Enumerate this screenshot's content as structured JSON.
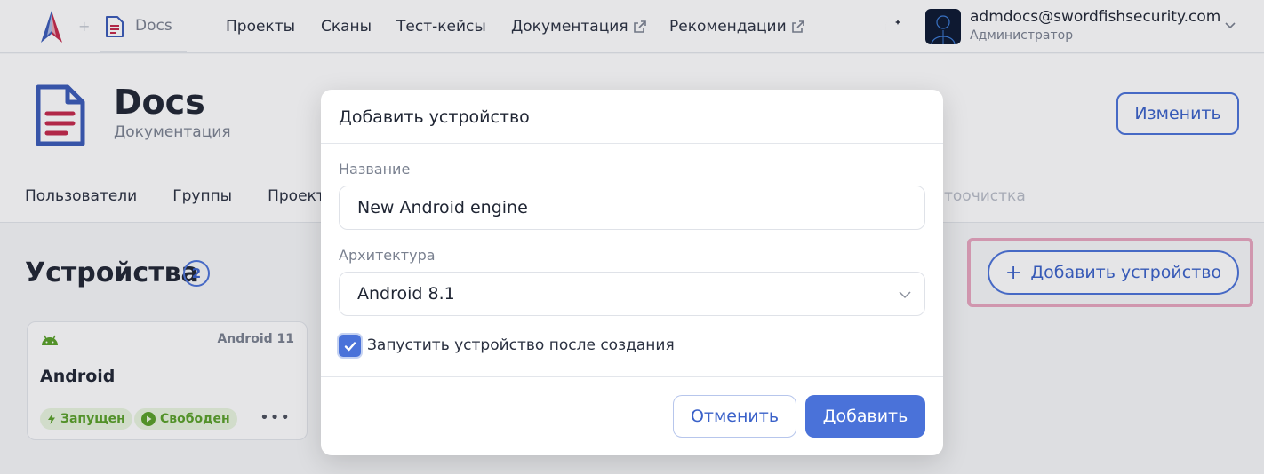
{
  "topbar": {
    "plus_sep": "+",
    "app_name": "Docs",
    "nav": [
      {
        "label": "Проекты",
        "external": false
      },
      {
        "label": "Сканы",
        "external": false
      },
      {
        "label": "Тест-кейсы",
        "external": false
      },
      {
        "label": "Документация",
        "external": true
      },
      {
        "label": "Рекомендации",
        "external": true
      }
    ],
    "user_email": "admdocs@swordfishsecurity.com",
    "user_role": "Администратор"
  },
  "page_header": {
    "title": "Docs",
    "subtitle": "Документация",
    "edit_label": "Изменить",
    "tabs": [
      "Пользователи",
      "Группы",
      "Проект"
    ],
    "tab_ghost": "тоочистка"
  },
  "devices": {
    "title": "Устройства",
    "count": "2",
    "add_label": "Добавить устройство",
    "add_plus": "+",
    "cards": [
      {
        "os_version": "Android 11",
        "name": "Android",
        "status_running": "Запущен",
        "status_free": "Свободен",
        "more": "•••"
      }
    ]
  },
  "modal": {
    "title": "Добавить устройство",
    "name_label": "Название",
    "name_value": "New Android engine",
    "arch_label": "Архитектура",
    "arch_value": "Android 8.1",
    "start_checked": true,
    "start_label": "Запустить устройство после создания",
    "cancel_label": "Отменить",
    "submit_label": "Добавить"
  },
  "colors": {
    "accent": "#4a72d9",
    "highlight": "#e7a5bf",
    "status_green": "#58a027",
    "doc_icon_blue": "#3a5bb8",
    "doc_icon_red": "#c4284a"
  },
  "icons": {
    "logo": "swordfish-logo",
    "app": "document-icon",
    "theme": "moon-icon",
    "external": "external-link-icon",
    "select": "chevron-down-icon",
    "android": "android-icon",
    "check": "check-icon"
  }
}
